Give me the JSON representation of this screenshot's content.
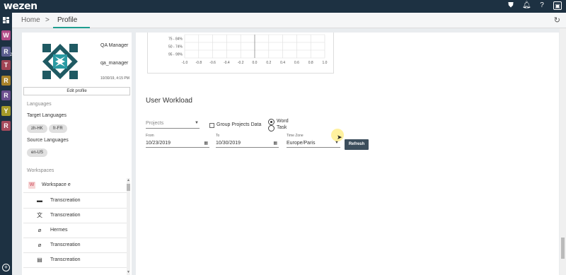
{
  "app": {
    "logo": "wezen"
  },
  "topbar": {
    "icons": [
      "shield-icon",
      "bell-icon",
      "help-icon",
      "avatar-icon"
    ]
  },
  "rail": {
    "items": [
      {
        "letter": "W",
        "color": "#b04a86"
      },
      {
        "letter": "R",
        "color": "#5b5e8f",
        "sub": "2"
      },
      {
        "letter": "T",
        "color": "#a04454"
      },
      {
        "letter": "R",
        "color": "#a8822a"
      },
      {
        "letter": "R",
        "color": "#6c4f8e"
      },
      {
        "letter": "Y",
        "color": "#a59a28"
      },
      {
        "letter": "R",
        "color": "#a64a5d"
      }
    ],
    "add_label": "+"
  },
  "breadcrumb": {
    "home": "Home",
    "separator": ">",
    "current": "Profile"
  },
  "profile": {
    "name": "QA Manager",
    "username": "qa_manager",
    "date": "10/30/19, 4:15 PM",
    "edit_label": "Edit profile"
  },
  "languages": {
    "section_title": "Languages",
    "target_label": "Target Languages",
    "target": [
      "zh-HK",
      "fr-FR"
    ],
    "source_label": "Source Languages",
    "source": [
      "en-US"
    ]
  },
  "workspaces": {
    "section_title": "Workspaces",
    "header": {
      "icon_letter": "W",
      "label": "Workspace e"
    },
    "items": [
      {
        "icon": "subtitles-icon",
        "glyph": "▬",
        "label": "Transcreation"
      },
      {
        "icon": "translate-icon",
        "glyph": "文",
        "label": "Transcreation"
      },
      {
        "icon": "paperclip-icon",
        "glyph": "⌀",
        "label": "Hermes"
      },
      {
        "icon": "paperclip-icon",
        "glyph": "⌀",
        "label": "Transcreation"
      },
      {
        "icon": "document-stack-icon",
        "glyph": "▤",
        "label": "Transcreation"
      }
    ]
  },
  "chart_data": {
    "type": "heatmap",
    "y_categories": [
      "75 - 84%",
      "50 - 74%",
      "95 - 99%"
    ],
    "x_ticks": [
      "-1.0",
      "-0.8",
      "-0.6",
      "-0.4",
      "-0.2",
      "0.0",
      "0.2",
      "0.4",
      "0.6",
      "0.8",
      "1.0"
    ],
    "xlim": [
      -1.0,
      1.0
    ],
    "grid": true
  },
  "workload": {
    "title": "User Workload",
    "projects_placeholder": "Projects",
    "group_label": "Group Projects Data",
    "group_checked": false,
    "unit_options": [
      {
        "label": "Word",
        "checked": true
      },
      {
        "label": "Task",
        "checked": false
      }
    ],
    "from_label": "From",
    "from_value": "10/23/2019",
    "to_label": "To",
    "to_value": "10/30/2019",
    "timezone_label": "Time Zone",
    "timezone_value": "Europe/Paris",
    "refresh_label": "Refresh"
  }
}
